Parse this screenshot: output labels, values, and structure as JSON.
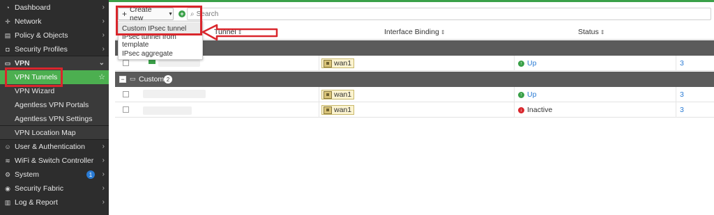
{
  "sidebar": {
    "items": [
      {
        "label": "Dashboard",
        "icon": "dashboard-icon"
      },
      {
        "label": "Network",
        "icon": "network-icon"
      },
      {
        "label": "Policy & Objects",
        "icon": "policy-icon"
      },
      {
        "label": "Security Profiles",
        "icon": "lock-icon"
      },
      {
        "label": "VPN",
        "icon": "monitor-icon"
      },
      {
        "label": "VPN Tunnels"
      },
      {
        "label": "VPN Wizard"
      },
      {
        "label": "Agentless VPN Portals"
      },
      {
        "label": "Agentless VPN Settings"
      },
      {
        "label": "VPN Location Map"
      },
      {
        "label": "User & Authentication",
        "icon": "user-icon"
      },
      {
        "label": "WiFi & Switch Controller",
        "icon": "wifi-icon"
      },
      {
        "label": "System",
        "icon": "gear-icon",
        "badge": "1"
      },
      {
        "label": "Security Fabric",
        "icon": "fabric-icon"
      },
      {
        "label": "Log & Report",
        "icon": "chart-icon"
      }
    ]
  },
  "toolbar": {
    "create_label": "Create new",
    "search_placeholder": "Search"
  },
  "dropdown": {
    "options": [
      "Custom IPsec tunnel",
      "IPsec tunnel from template",
      "IPsec aggregate"
    ]
  },
  "table": {
    "columns": [
      "Tunnel",
      "Interface Binding",
      "Status"
    ],
    "group": {
      "label": "Custom",
      "count": "2"
    },
    "rows": [
      {
        "interface": "wan1",
        "status": "Up",
        "ref": "3"
      },
      {
        "interface": "wan1",
        "status": "Up",
        "ref": "3"
      },
      {
        "interface": "wan1",
        "status": "Inactive",
        "ref": "3"
      }
    ]
  },
  "colors": {
    "accent_green": "#3aa048",
    "active_nav": "#4caf50",
    "annotation_red": "#d9262c",
    "link_blue": "#2a7bd4"
  }
}
